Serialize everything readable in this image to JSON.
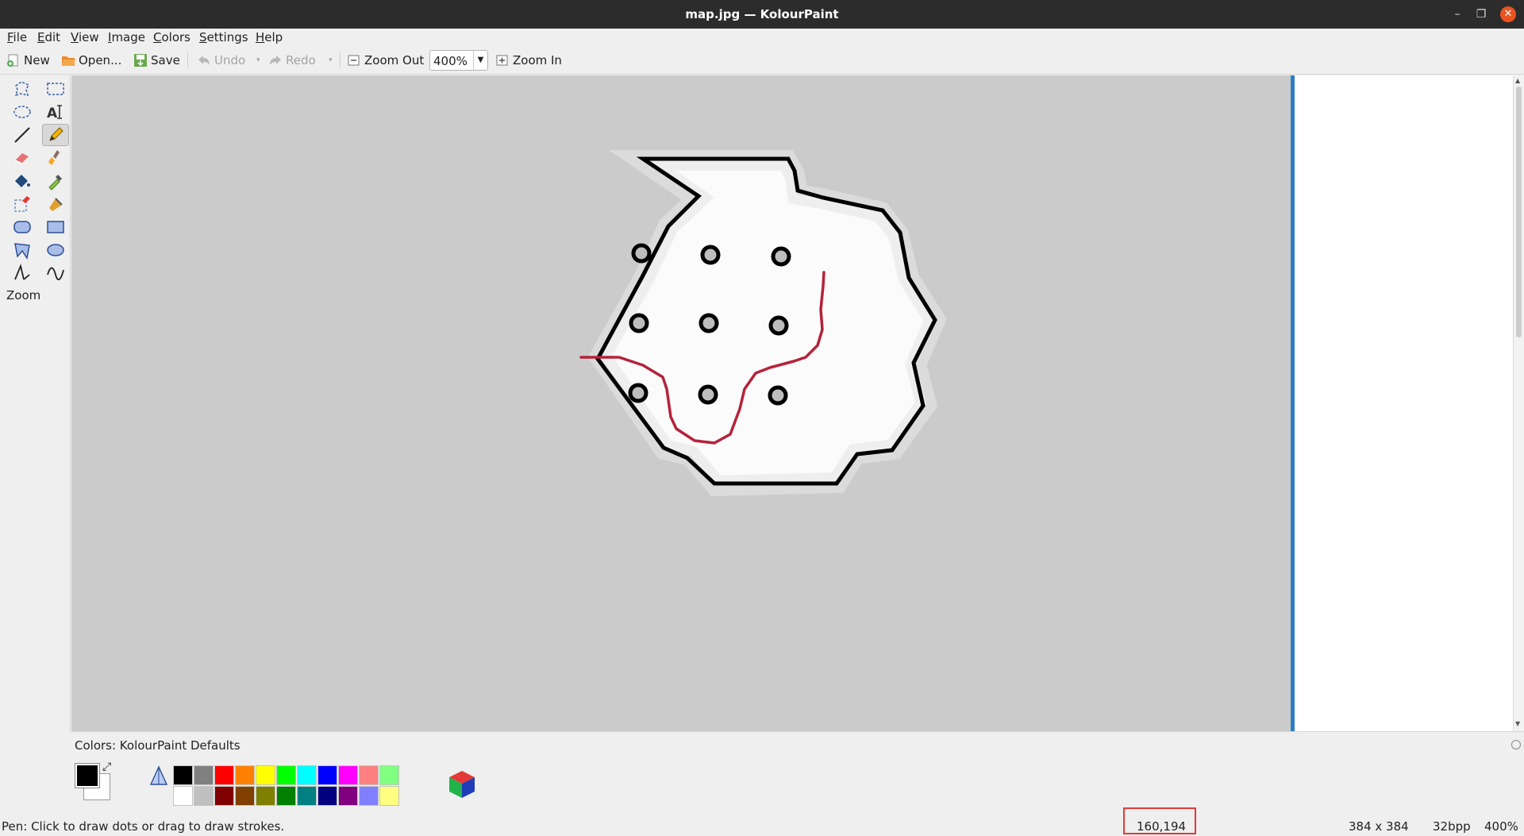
{
  "window": {
    "title": "map.jpg — KolourPaint"
  },
  "menu": [
    "File",
    "Edit",
    "View",
    "Image",
    "Colors",
    "Settings",
    "Help"
  ],
  "toolbar": {
    "new_label": "New",
    "open_label": "Open...",
    "save_label": "Save",
    "undo_label": "Undo",
    "redo_label": "Redo",
    "zoom_out_label": "Zoom Out",
    "zoom_value": "400%",
    "zoom_in_label": "Zoom In"
  },
  "tools": [
    "free-form-selection",
    "rectangular-selection",
    "elliptical-selection",
    "text",
    "line",
    "pen",
    "eraser",
    "brush",
    "flood-fill",
    "color-picker",
    "color-eraser",
    "spraycan",
    "rounded-rectangle",
    "rectangle",
    "polygon",
    "ellipse",
    "connected-lines",
    "curve"
  ],
  "active_tool": "pen",
  "zoom_tool_label": "Zoom",
  "colors_panel": {
    "label": "Colors: KolourPaint Defaults",
    "foreground": "#000000",
    "background": "#ffffff",
    "top_row": [
      "#000000",
      "#808080",
      "#ff0000",
      "#ff8000",
      "#ffff00",
      "#00ff00",
      "#00ffff",
      "#0000ff",
      "#ff00ff",
      "#ff8080",
      "#80ff80"
    ],
    "bottom_row": [
      "#ffffff",
      "#c0c0c0",
      "#800000",
      "#804000",
      "#808000",
      "#008000",
      "#008080",
      "#000080",
      "#800080",
      "#8080ff",
      "#ffff80"
    ]
  },
  "status": {
    "message": "Pen: Click to draw dots or drag to draw strokes.",
    "coordinates": "160,194",
    "image_size": "384 x 384",
    "bit_depth": "32bpp",
    "zoom": "400%"
  },
  "colors": {
    "accent": "#2b7fc5",
    "titlebar": "#2c2c2c",
    "close_button": "#e95420",
    "stroke_red": "#b5223a"
  }
}
